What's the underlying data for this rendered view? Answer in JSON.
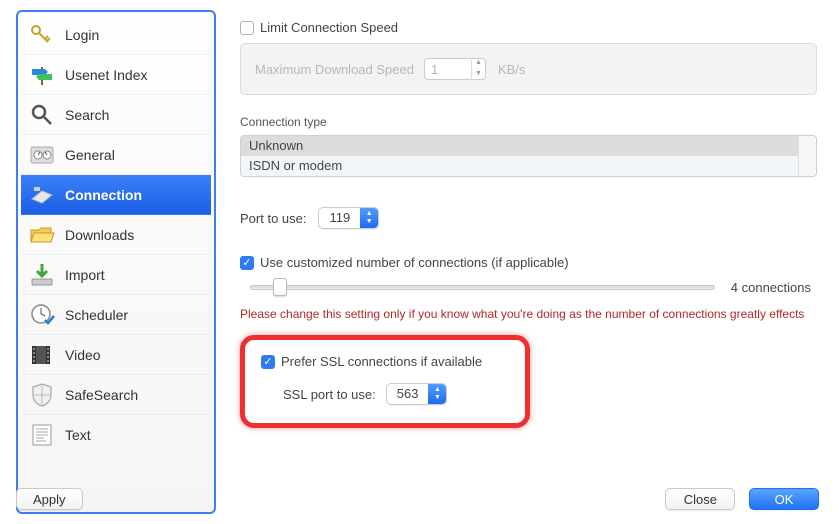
{
  "sidebar": {
    "selected_index": 4,
    "items": [
      {
        "label": "Login"
      },
      {
        "label": "Usenet Index"
      },
      {
        "label": "Search"
      },
      {
        "label": "General"
      },
      {
        "label": "Connection"
      },
      {
        "label": "Downloads"
      },
      {
        "label": "Import"
      },
      {
        "label": "Scheduler"
      },
      {
        "label": "Video"
      },
      {
        "label": "SafeSearch"
      },
      {
        "label": "Text"
      }
    ]
  },
  "speed": {
    "limit_label": "Limit Connection Speed",
    "limit_checked": false,
    "max_label": "Maximum Download Speed",
    "value": "1",
    "unit": "KB/s"
  },
  "conn_type": {
    "legend": "Connection type",
    "options": [
      "Unknown",
      "ISDN or modem"
    ],
    "selected_index": 0
  },
  "port": {
    "label": "Port to use:",
    "value": "119"
  },
  "custom_conns": {
    "label": "Use customized number of connections (if applicable)",
    "checked": true,
    "count_label": "4 connections",
    "slider_percent": 5,
    "warning": "Please change this setting only if you know what you're doing as the number of connections greatly effects"
  },
  "ssl": {
    "prefer_label": "Prefer SSL connections if available",
    "prefer_checked": true,
    "port_label": "SSL port to use:",
    "port_value": "563"
  },
  "buttons": {
    "apply": "Apply",
    "close": "Close",
    "ok": "OK"
  }
}
